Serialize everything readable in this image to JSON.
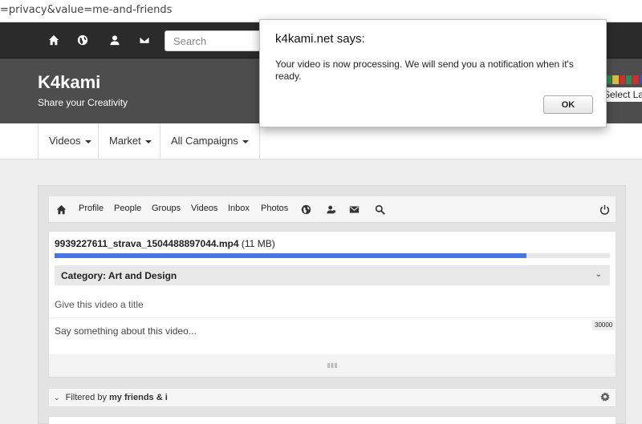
{
  "browser": {
    "url_fragment": "=privacy&value=me-and-friends"
  },
  "topnav": {
    "icons": [
      "home-icon",
      "globe-icon",
      "user-icon",
      "envelope-icon"
    ],
    "search_placeholder": "Search"
  },
  "header": {
    "brand": "K4kami",
    "tagline": "Share your Creativity",
    "language_label": "Select Language",
    "flag_colors": [
      "#2e8b57",
      "#d8c13a",
      "#cf2e2e",
      "#2e8b57",
      "#cf2e2e",
      "#3a55a6"
    ]
  },
  "subnav": {
    "items": [
      "Videos",
      "Market",
      "All Campaigns"
    ]
  },
  "innernav": {
    "home_icon": "home-icon",
    "links": [
      "Profile",
      "People",
      "Groups",
      "Videos",
      "Inbox",
      "Photos"
    ],
    "icons": [
      "globe-icon",
      "user-pin-icon",
      "envelope-icon",
      "search-icon",
      "power-icon"
    ]
  },
  "upload": {
    "filename": "9939227611_strava_1504488897044.mp4",
    "filesize": "(11 MB)",
    "progress": 0.85,
    "progress_color": "#4a76e5",
    "category": "Category: Art and Design",
    "title_placeholder": "Give this video a title",
    "description_placeholder": "Say something about this video...",
    "char_counter": "30000"
  },
  "feed": {
    "filter_prefix": "Filtered by",
    "filter_value": "my friends & i"
  },
  "dialog": {
    "title": "k4kami.net says:",
    "message": "Your video is now processing. We will send you a notification when it's ready.",
    "ok_label": "OK"
  }
}
